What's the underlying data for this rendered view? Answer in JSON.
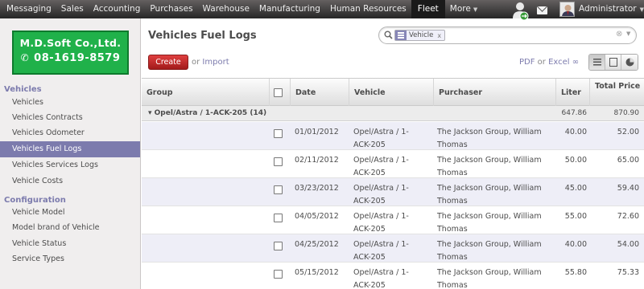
{
  "topbar": {
    "menu": [
      {
        "label": "Messaging"
      },
      {
        "label": "Sales"
      },
      {
        "label": "Accounting"
      },
      {
        "label": "Purchases"
      },
      {
        "label": "Warehouse"
      },
      {
        "label": "Manufacturing"
      },
      {
        "label": "Human Resources"
      },
      {
        "label": "Fleet"
      },
      {
        "label": "More"
      }
    ],
    "user": "Administrator"
  },
  "sidebar": {
    "logo_line1": "M.D.Soft Co.,Ltd.",
    "logo_line2": "08-1619-8579",
    "section1": "Vehicles",
    "items1": [
      "Vehicles",
      "Vehicles Contracts",
      "Vehicles Odometer",
      "Vehicles Fuel Logs",
      "Vehicles Services Logs",
      "Vehicle Costs"
    ],
    "section2": "Configuration",
    "items2": [
      "Vehicle Model",
      "Model brand of Vehicle",
      "Vehicle Status",
      "Service Types"
    ]
  },
  "main": {
    "title": "Vehicles Fuel Logs",
    "search": {
      "facet_value": "Vehicle",
      "facet_close": "x",
      "placeholder": ""
    },
    "create_label": "Create",
    "or_text": "or",
    "import_label": "Import",
    "pdf_label": "PDF",
    "or2_text": "or",
    "excel_label": "Excel"
  },
  "table": {
    "headers": {
      "group": "Group",
      "date": "Date",
      "vehicle": "Vehicle",
      "purchaser": "Purchaser",
      "liter": "Liter",
      "total_price": "Total Price"
    },
    "group": {
      "label": "Opel/Astra / 1-ACK-205 (14)",
      "liter": "647.86",
      "total_price": "870.90"
    },
    "rows": [
      {
        "date": "01/01/2012",
        "vehicle": "Opel/Astra / 1-ACK-205",
        "purchaser": "The Jackson Group, William Thomas",
        "liter": "40.00",
        "total_price": "52.00"
      },
      {
        "date": "02/11/2012",
        "vehicle": "Opel/Astra / 1-ACK-205",
        "purchaser": "The Jackson Group, William Thomas",
        "liter": "50.00",
        "total_price": "65.00"
      },
      {
        "date": "03/23/2012",
        "vehicle": "Opel/Astra / 1-ACK-205",
        "purchaser": "The Jackson Group, William Thomas",
        "liter": "45.00",
        "total_price": "59.40"
      },
      {
        "date": "04/05/2012",
        "vehicle": "Opel/Astra / 1-ACK-205",
        "purchaser": "The Jackson Group, William Thomas",
        "liter": "55.00",
        "total_price": "72.60"
      },
      {
        "date": "04/25/2012",
        "vehicle": "Opel/Astra / 1-ACK-205",
        "purchaser": "The Jackson Group, William Thomas",
        "liter": "40.00",
        "total_price": "54.00"
      },
      {
        "date": "05/15/2012",
        "vehicle": "Opel/Astra / 1-ACK-205",
        "purchaser": "The Jackson Group, William Thomas",
        "liter": "55.80",
        "total_price": "75.33"
      }
    ]
  }
}
